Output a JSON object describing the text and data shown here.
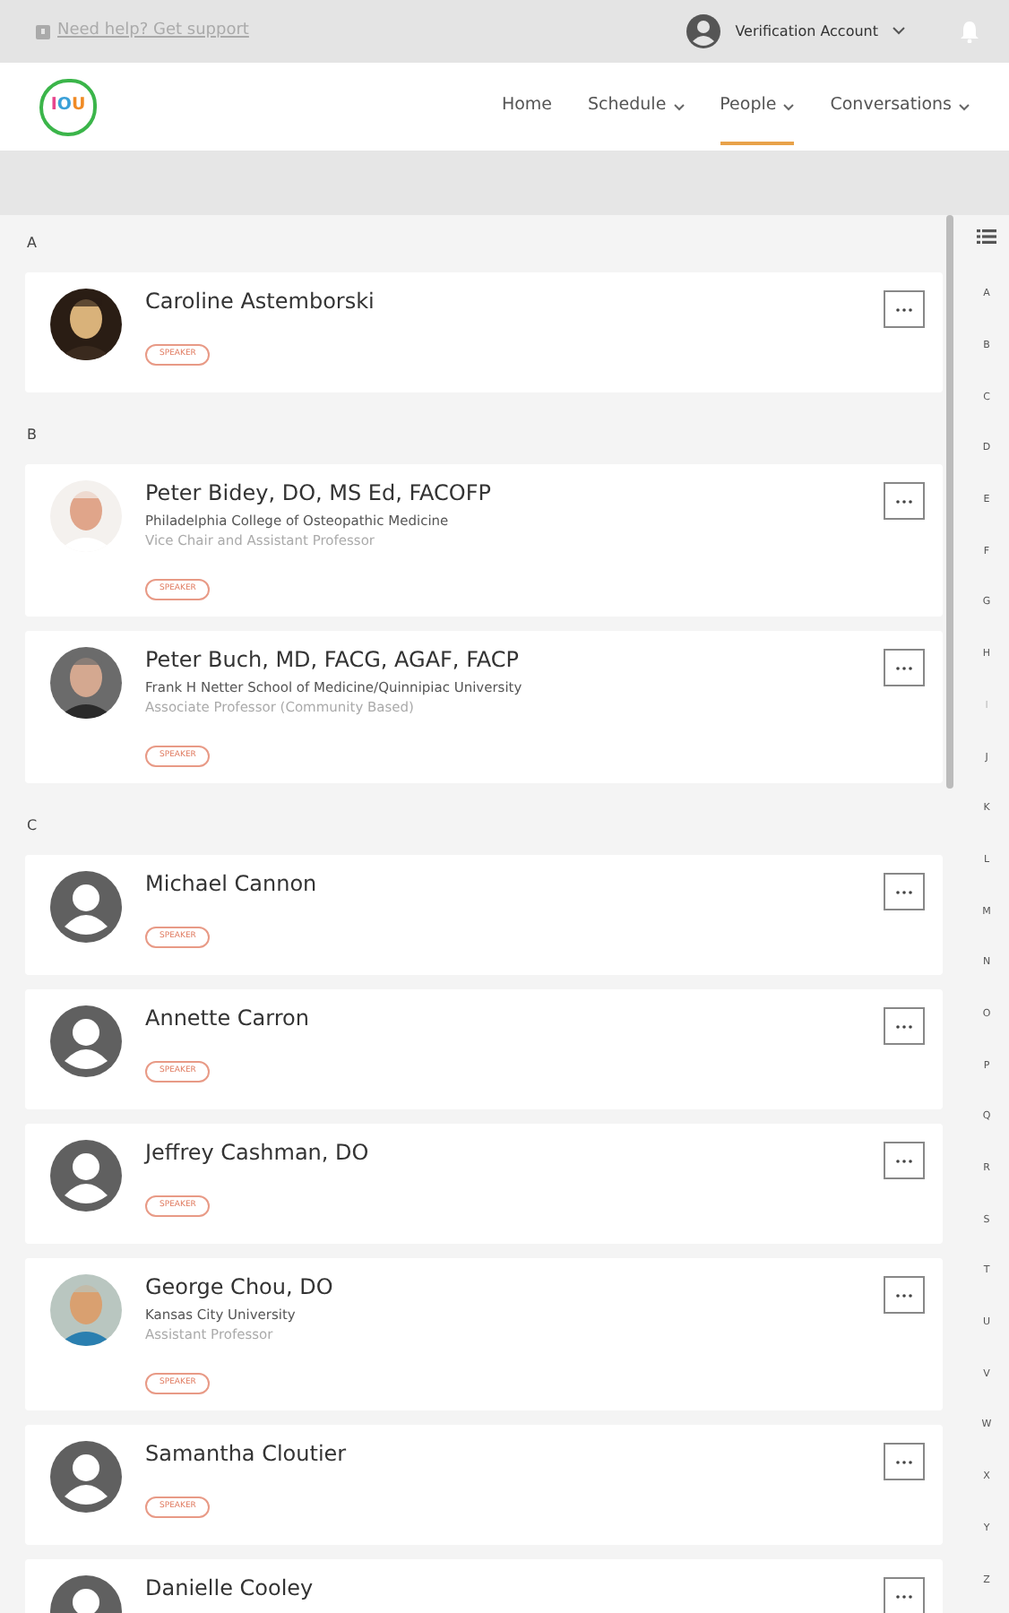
{
  "topbar": {
    "help_text": "Need help? Get support",
    "account": "Verification Account"
  },
  "navbar": {
    "logo": "IOU",
    "items": [
      {
        "label": "Home",
        "dropdown": false,
        "selected": false
      },
      {
        "label": "Schedule",
        "dropdown": true,
        "selected": false
      },
      {
        "label": "People",
        "dropdown": true,
        "selected": true
      },
      {
        "label": "Conversations",
        "dropdown": true,
        "selected": false
      }
    ]
  },
  "sections": [
    {
      "letter": "A",
      "people": [
        {
          "name": "Caroline Astemborski",
          "badge": "SPEAKER"
        }
      ]
    },
    {
      "letter": "B",
      "people": [
        {
          "name": "Peter Bidey, DO, MS Ed, FACOFP",
          "organization": "Philadelphia College of Osteopathic Medicine",
          "title": "Vice Chair and Assistant Professor",
          "badge": "SPEAKER"
        },
        {
          "name": "Peter Buch, MD, FACG, AGAF, FACP",
          "organization": "Frank H Netter School of Medicine/Quinnipiac University",
          "title": "Associate Professor (Community Based)",
          "badge": "SPEAKER"
        }
      ]
    },
    {
      "letter": "C",
      "people": [
        {
          "name": "Michael Cannon",
          "kind": "default",
          "badge": "SPEAKER"
        },
        {
          "name": "Annette Carron",
          "kind": "default",
          "badge": "SPEAKER"
        },
        {
          "name": "Jeffrey Cashman, DO",
          "kind": "default",
          "badge": "SPEAKER"
        },
        {
          "name": "George Chou, DO",
          "organization": "Kansas City University",
          "title": "Assistant Professor",
          "badge": "SPEAKER"
        },
        {
          "name": "Samantha Cloutier",
          "kind": "default",
          "badge": "SPEAKER"
        },
        {
          "name": "Danielle Cooley",
          "kind": "default"
        }
      ]
    }
  ],
  "index": [
    {
      "letter": "A",
      "disabled": false
    },
    {
      "letter": "B",
      "disabled": false
    },
    {
      "letter": "C",
      "disabled": false
    },
    {
      "letter": "D",
      "disabled": false
    },
    {
      "letter": "E",
      "disabled": false
    },
    {
      "letter": "F",
      "disabled": false
    },
    {
      "letter": "G",
      "disabled": false
    },
    {
      "letter": "H",
      "disabled": false
    },
    {
      "letter": "I",
      "disabled": true
    },
    {
      "letter": "J",
      "disabled": false
    },
    {
      "letter": "K",
      "disabled": false
    },
    {
      "letter": "L",
      "disabled": false
    },
    {
      "letter": "M",
      "disabled": false
    },
    {
      "letter": "N",
      "disabled": false
    },
    {
      "letter": "O",
      "disabled": false
    },
    {
      "letter": "P",
      "disabled": false
    },
    {
      "letter": "Q",
      "disabled": false
    },
    {
      "letter": "R",
      "disabled": false
    },
    {
      "letter": "S",
      "disabled": false
    },
    {
      "letter": "T",
      "disabled": false
    },
    {
      "letter": "U",
      "disabled": false
    },
    {
      "letter": "V",
      "disabled": false
    },
    {
      "letter": "W",
      "disabled": false
    },
    {
      "letter": "X",
      "disabled": false
    },
    {
      "letter": "Y",
      "disabled": false
    },
    {
      "letter": "Z",
      "disabled": false
    }
  ]
}
